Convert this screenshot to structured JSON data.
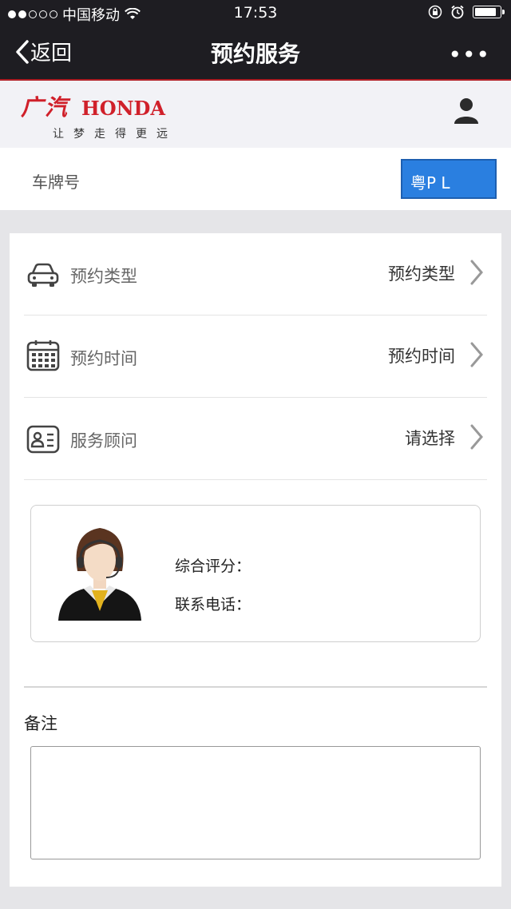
{
  "status_bar": {
    "carrier": "中国移动",
    "time": "17:53",
    "battery_level": 0.9
  },
  "nav": {
    "back_label": "返回",
    "title": "预约服务",
    "more_label": "•••"
  },
  "brand": {
    "logo_cn": "广汽",
    "logo_en": "HONDA",
    "slogan": "让梦走得更远",
    "accent_color": "#d0202a"
  },
  "plate": {
    "label": "车牌号",
    "value": "粤P L"
  },
  "rows": [
    {
      "icon": "car-icon",
      "label": "预约类型",
      "value": "预约类型"
    },
    {
      "icon": "calendar-icon",
      "label": "预约时间",
      "value": "预约时间"
    },
    {
      "icon": "id-card-icon",
      "label": "服务顾问",
      "value": "请选择"
    }
  ],
  "consultant": {
    "rating_label": "综合评分：",
    "phone_label": "联系电话："
  },
  "notes": {
    "label": "备注",
    "value": ""
  }
}
